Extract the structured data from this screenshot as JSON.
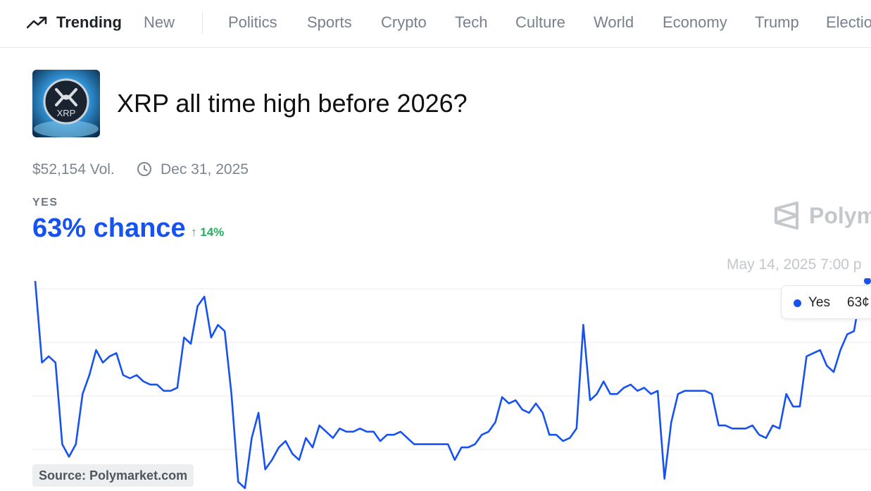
{
  "nav": {
    "trending_label": "Trending",
    "items": [
      "New",
      "Politics",
      "Sports",
      "Crypto",
      "Tech",
      "Culture",
      "World",
      "Economy",
      "Trump",
      "Electio"
    ]
  },
  "market": {
    "logo_text": "XRP",
    "title": "XRP all time high before 2026?",
    "volume": "$52,154 Vol.",
    "end_date": "Dec 31, 2025",
    "outcome_label": "YES",
    "chance": "63% chance",
    "change": "14%"
  },
  "watermark": "Polym",
  "chart_hover": {
    "date": "May 14, 2025 7:00 p",
    "series_label": "Yes",
    "value": "63¢"
  },
  "source": "Source: Polymarket.com",
  "colors": {
    "line": "#1652f0",
    "positive": "#27ae60"
  },
  "chart_data": {
    "type": "line",
    "series": [
      {
        "name": "Yes",
        "values": [
          63,
          50,
          51,
          50,
          37,
          35,
          37,
          45,
          48,
          52,
          50,
          51,
          51.5,
          48,
          47.5,
          48,
          47,
          46.5,
          46.5,
          45.5,
          45.5,
          46,
          54,
          53,
          59,
          60.5,
          54,
          56,
          55,
          45,
          31,
          30,
          38,
          42,
          33,
          34.5,
          36.5,
          37.5,
          35.5,
          34.5,
          38,
          36.5,
          40,
          39,
          38,
          39.5,
          39,
          39,
          39.5,
          39,
          39,
          37.5,
          38.5,
          38.5,
          39,
          38,
          37,
          37,
          37,
          37,
          37,
          37,
          34.5,
          36.5,
          36.5,
          37,
          38.5,
          39,
          40.5,
          44.5,
          43.5,
          44,
          42.5,
          42,
          43.5,
          42,
          38.5,
          38.5,
          37.5,
          38,
          39.5,
          56,
          44,
          45,
          47,
          45,
          45,
          46,
          46.5,
          45.5,
          46,
          45,
          45.5,
          31.5,
          40.5,
          45,
          45.5,
          45.5,
          45.5,
          45.5,
          45,
          40,
          40,
          39.5,
          39.5,
          39.5,
          40,
          38.5,
          38,
          40,
          39.5,
          45,
          43,
          43,
          51,
          51.5,
          52,
          49.5,
          48.5,
          52,
          54.5,
          55,
          61,
          63
        ]
      }
    ],
    "ylim": [
      30,
      65
    ],
    "grid": true
  }
}
